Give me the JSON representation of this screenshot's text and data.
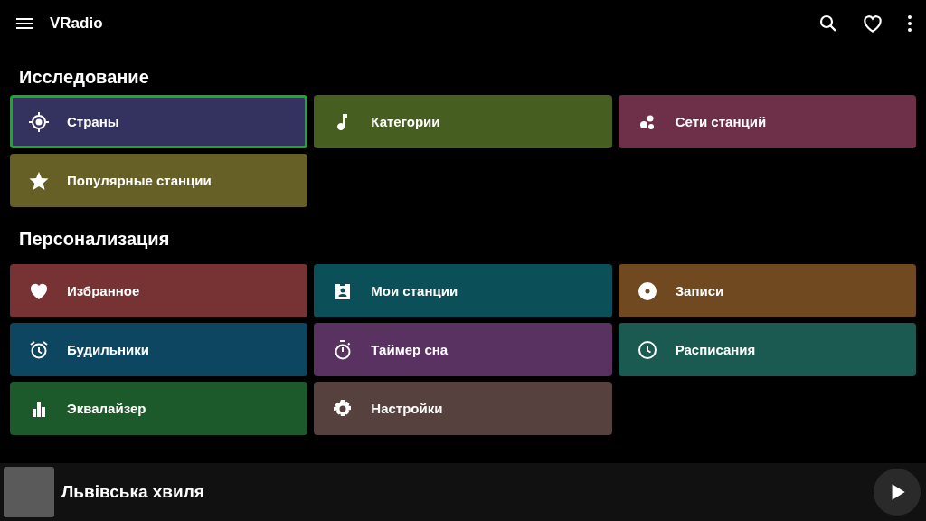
{
  "app_bar": {
    "title": "VRadio"
  },
  "sections": [
    {
      "title": "Исследование",
      "tiles": [
        {
          "label": "Страны",
          "kind": "target",
          "color": "#343360",
          "selected": true
        },
        {
          "label": "Категории",
          "kind": "note",
          "color": "#465e1f",
          "selected": false
        },
        {
          "label": "Сети станций",
          "kind": "dots",
          "color": "#6e3049",
          "selected": false
        },
        {
          "label": "Популярные станции",
          "kind": "star",
          "color": "#676026",
          "selected": false
        }
      ]
    },
    {
      "title": "Персонализация",
      "tiles": [
        {
          "label": "Избранное",
          "kind": "heart",
          "color": "#773234",
          "selected": false
        },
        {
          "label": "Мои станции",
          "kind": "badge",
          "color": "#0b5059",
          "selected": false
        },
        {
          "label": "Записи",
          "kind": "disc",
          "color": "#704920",
          "selected": false
        },
        {
          "label": "Будильники",
          "kind": "alarm",
          "color": "#0c4660",
          "selected": false
        },
        {
          "label": "Таймер сна",
          "kind": "timer",
          "color": "#5a3262",
          "selected": false
        },
        {
          "label": "Расписания",
          "kind": "clock",
          "color": "#1b5a51",
          "selected": false
        },
        {
          "label": "Эквалайзер",
          "kind": "bars",
          "color": "#1c5a2c",
          "selected": false
        },
        {
          "label": "Настройки",
          "kind": "gear",
          "color": "#56413e",
          "selected": false
        }
      ]
    }
  ],
  "player": {
    "station": "Львівська хвиля"
  }
}
